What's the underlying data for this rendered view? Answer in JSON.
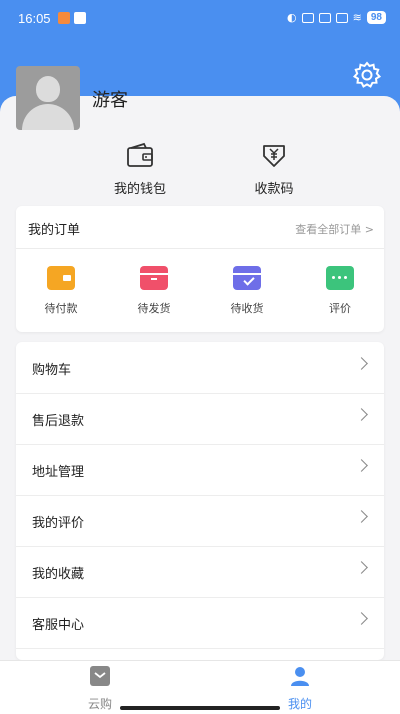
{
  "status_bar": {
    "time": "16:05",
    "battery": "98"
  },
  "profile": {
    "username": "游客"
  },
  "quick_actions": [
    {
      "label": "我的钱包",
      "icon": "wallet-icon"
    },
    {
      "label": "收款码",
      "icon": "yuan-receive-icon"
    }
  ],
  "orders": {
    "title": "我的订单",
    "view_all": "查看全部订单 >",
    "items": [
      {
        "label": "待付款",
        "icon": "wallet-pay-icon",
        "color": "#f5a623"
      },
      {
        "label": "待发货",
        "icon": "box-ship-icon",
        "color": "#f0506a"
      },
      {
        "label": "待收货",
        "icon": "receive-box-icon",
        "color": "#6e6ee8"
      },
      {
        "label": "评价",
        "icon": "comment-icon",
        "color": "#3cc47c"
      }
    ]
  },
  "menu": {
    "items": [
      {
        "label": "购物车"
      },
      {
        "label": "售后退款"
      },
      {
        "label": "地址管理"
      },
      {
        "label": "我的评价"
      },
      {
        "label": "我的收藏"
      },
      {
        "label": "客服中心"
      }
    ]
  },
  "tabbar": {
    "tabs": [
      {
        "label": "云购",
        "icon": "cloud-shop-icon",
        "color": "#888888"
      },
      {
        "label": "我的",
        "icon": "person-icon",
        "color": "#4a8ff0"
      }
    ]
  },
  "colors": {
    "primary": "#4a8ff0"
  }
}
